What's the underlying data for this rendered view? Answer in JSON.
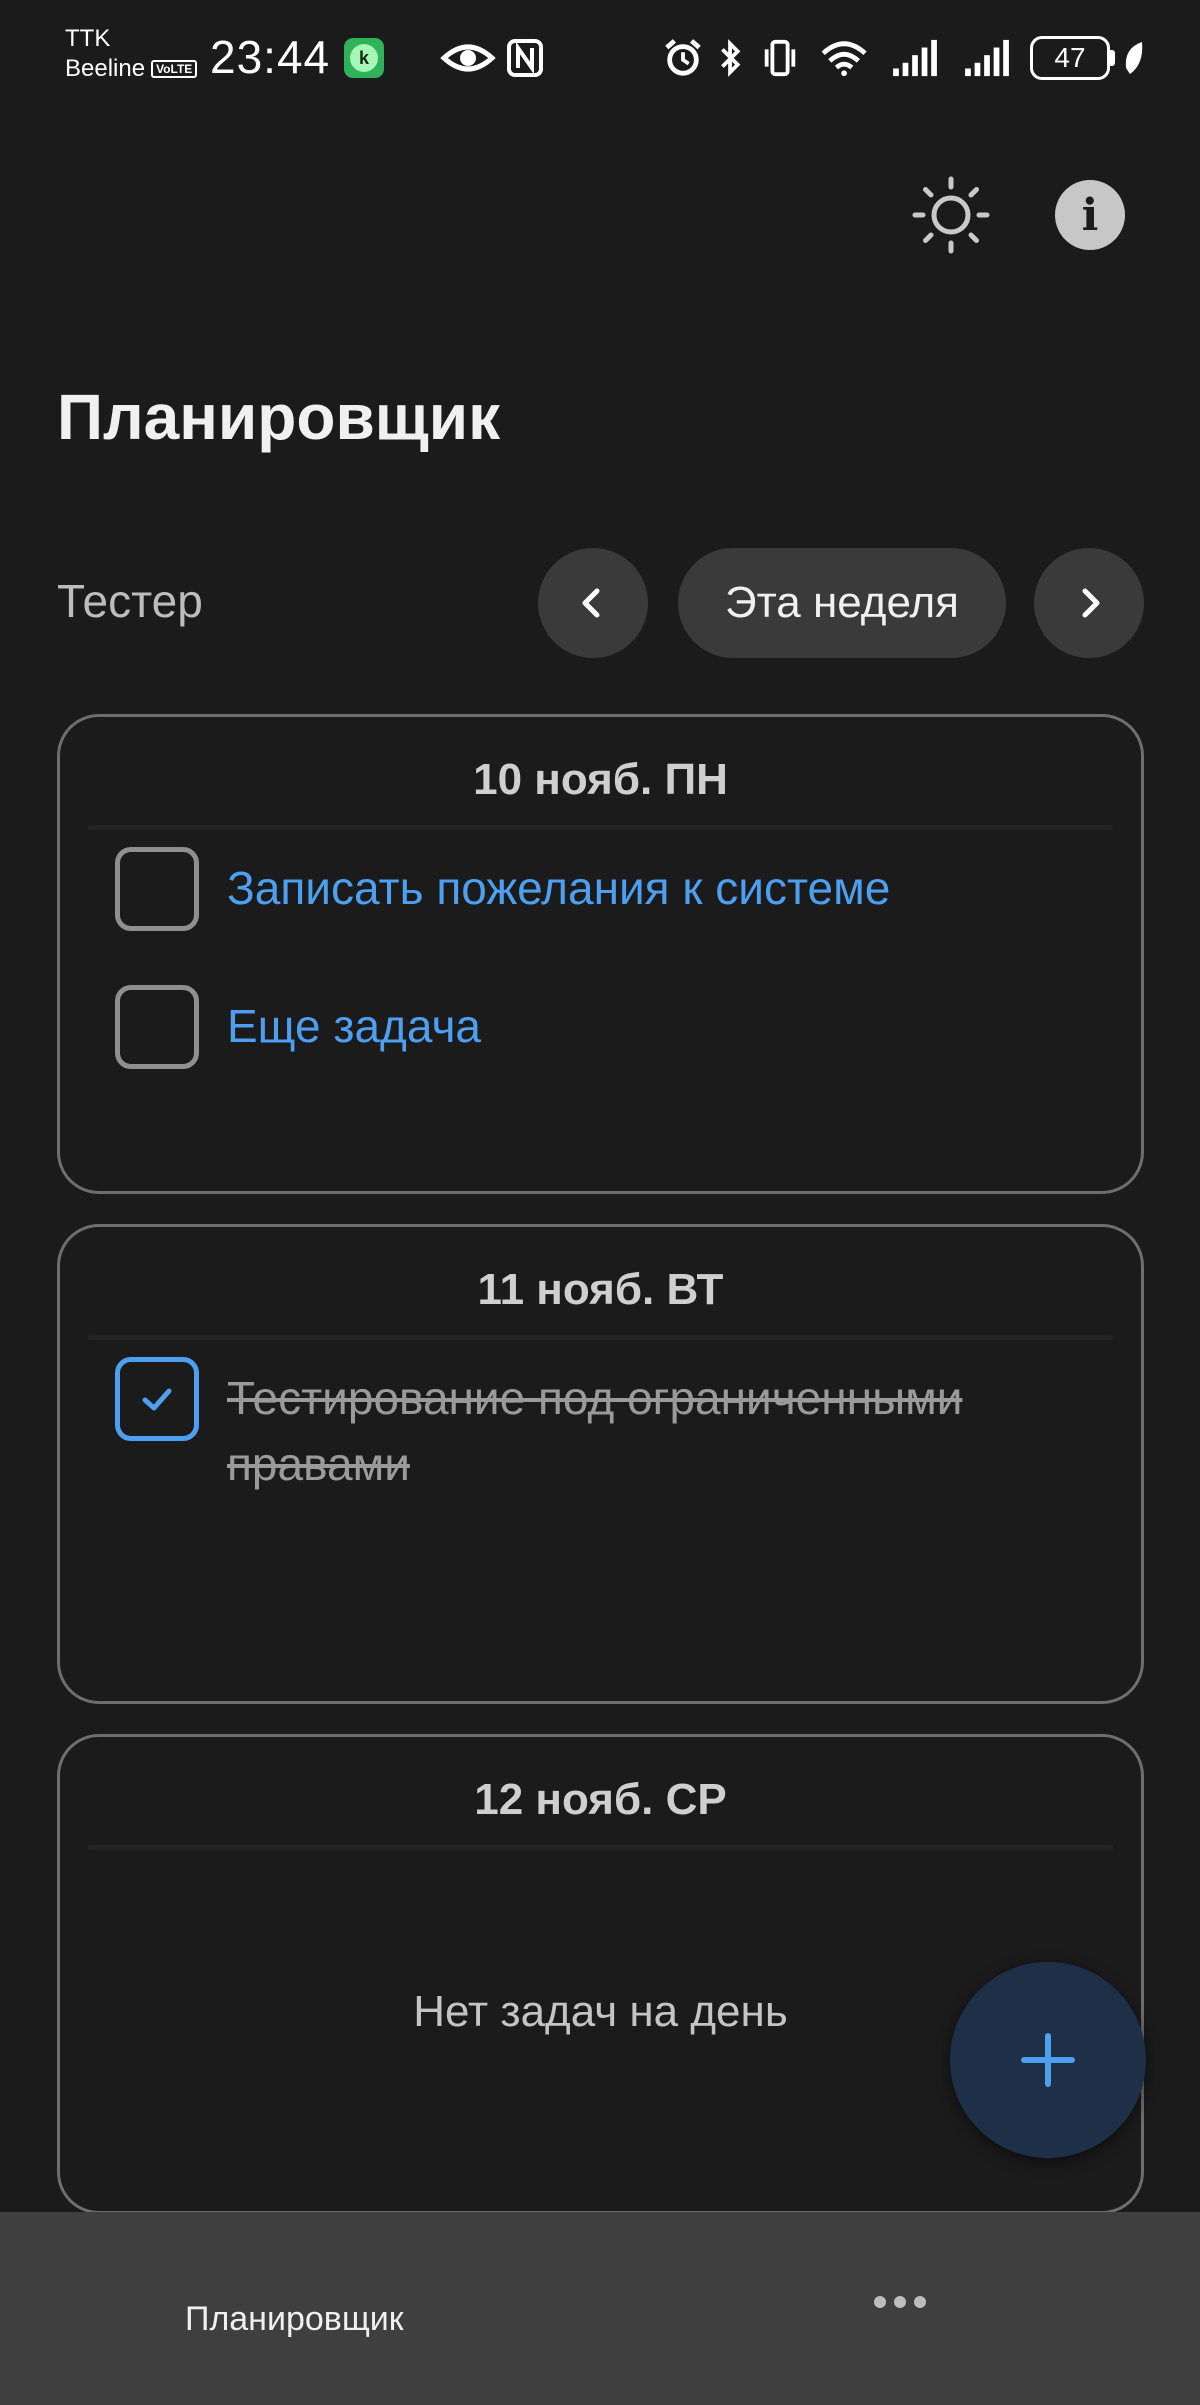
{
  "status_bar": {
    "carrier_1": "TTK",
    "carrier_2": "Beeline",
    "volte": "VoLTE",
    "time": "23:44",
    "battery": "47"
  },
  "header": {
    "title": "Планировщик",
    "icons": [
      "theme-toggle-sun-icon",
      "info-icon"
    ]
  },
  "filter": {
    "user": "Тестер",
    "week_label": "Эта неделя"
  },
  "days": [
    {
      "date": "10 нояб. ПН",
      "tasks": [
        {
          "title": "Записать пожелания к системе",
          "done": false
        },
        {
          "title": "Еще задача",
          "done": false
        }
      ]
    },
    {
      "date": "11 нояб. ВТ",
      "tasks": [
        {
          "title": "Тестирование под ограниченными правами",
          "done": true
        }
      ]
    },
    {
      "date": "12 нояб. СР",
      "tasks": [],
      "empty_text": "Нет задач на день"
    }
  ],
  "bottom_nav": {
    "tab_label": "Планировщик"
  },
  "colors": {
    "background": "#1b1b1b",
    "accent": "#4d9ff0",
    "fab": "#1d3047",
    "nav": "#3f3f3f"
  }
}
